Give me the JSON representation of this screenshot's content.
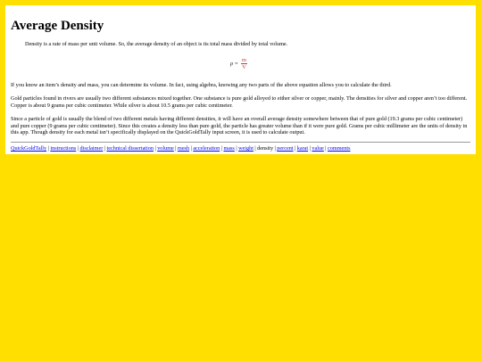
{
  "page": {
    "title": "Average Density",
    "intro": "Density is a rate of mass per unit volume. So, the average density of an object is its total mass divided by total volume.",
    "formula": {
      "lhs": "ρ =",
      "numerator": "m",
      "denominator": "V"
    },
    "paragraphs": [
      "If you know an item’s density and mass, you can determine its volume. In fact, using algebra, knowing any two parts of the above equation allows you to calculate the third.",
      "Gold particles found in rivers are usually two different substances mixed together. One substance is pure gold alloyed to either silver or copper, mainly. The densities for silver and copper aren’t too different. Copper is about 9 grams per cubic centimeter. While silver is about 10.5 grams per cubic centimeter.",
      "Since a particle of gold is usually the blend of two different metals having different densities, it will have an overall average density somewhere between that of pure gold (19.3 grams per cubic centimeter) and pure copper (9 grams per cubic centimeter). Since this creates a density less than pure gold, the particle has greater volume than if it were pure gold. Grams per cubic millimeter are the units of density in this app. Though density for each metal isn’t specifically displayed on the QuickGoldTally input screen, it is used to calculate output."
    ]
  },
  "footer": {
    "links": [
      "QuickGoldTally",
      "instructions",
      "disclaimer",
      "technical dissertation",
      "volume",
      "mesh",
      "acceleration",
      "mass",
      "weight"
    ],
    "current": "density",
    "links_after": [
      "percent",
      "karat",
      "value",
      "comments"
    ],
    "separator": "|"
  },
  "colors": {
    "background": "#ffdf00",
    "card": "#ffffff",
    "link": "#0000ee",
    "formula_accent": "#cc3333"
  }
}
